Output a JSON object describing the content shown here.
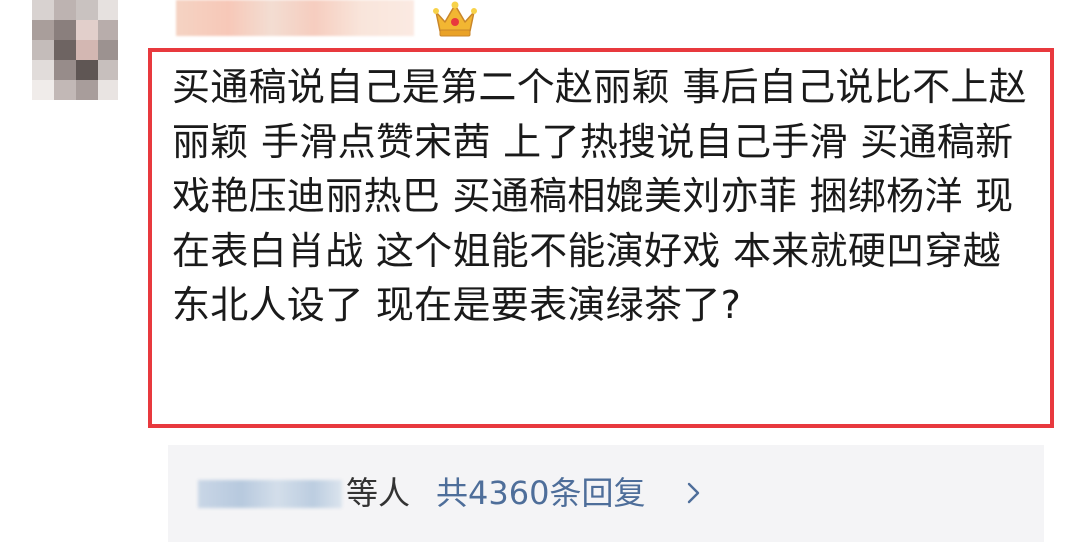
{
  "comment": {
    "text": "买通稿说自己是第二个赵丽颖  事后自己说比不上赵丽颖 手滑点赞宋茜 上了热搜说自己手滑  买通稿新戏艳压迪丽热巴  买通稿相媲美刘亦菲 捆绑杨洋 现在表白肖战 这个姐能不能演好戏 本来就硬凹穿越东北人设了 现在是要表演绿茶了?"
  },
  "replies": {
    "suffix": "等人",
    "count_link": "共4360条回复"
  },
  "icons": {
    "badge": "crown-icon",
    "more": "chevron-right-icon"
  },
  "colors": {
    "highlight_border": "#e8393e",
    "link": "#4e6e9a",
    "reply_background": "#f4f4f6",
    "crown": "#f2b632"
  }
}
